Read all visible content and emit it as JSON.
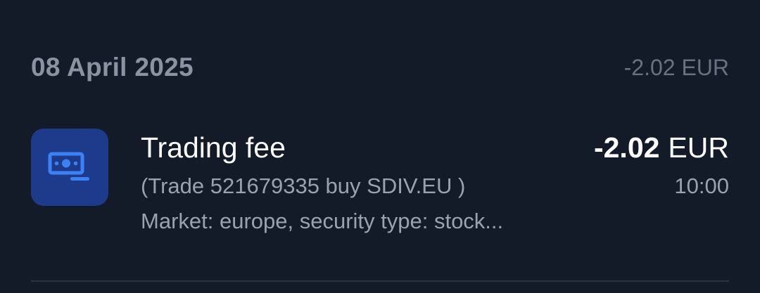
{
  "group": {
    "date": "08 April 2025",
    "total": "-2.02 EUR"
  },
  "transaction": {
    "icon": "banknote-icon",
    "title": "Trading fee",
    "subtitle": "(Trade 521679335 buy SDIV.EU )",
    "meta": "Market: europe, security type: stock...",
    "amount_value": "-2.02",
    "amount_currency": "EUR",
    "time": "10:00"
  },
  "colors": {
    "background": "#131a28",
    "icon_tile": "#1e3a8a",
    "icon_accent": "#3b82f6"
  }
}
